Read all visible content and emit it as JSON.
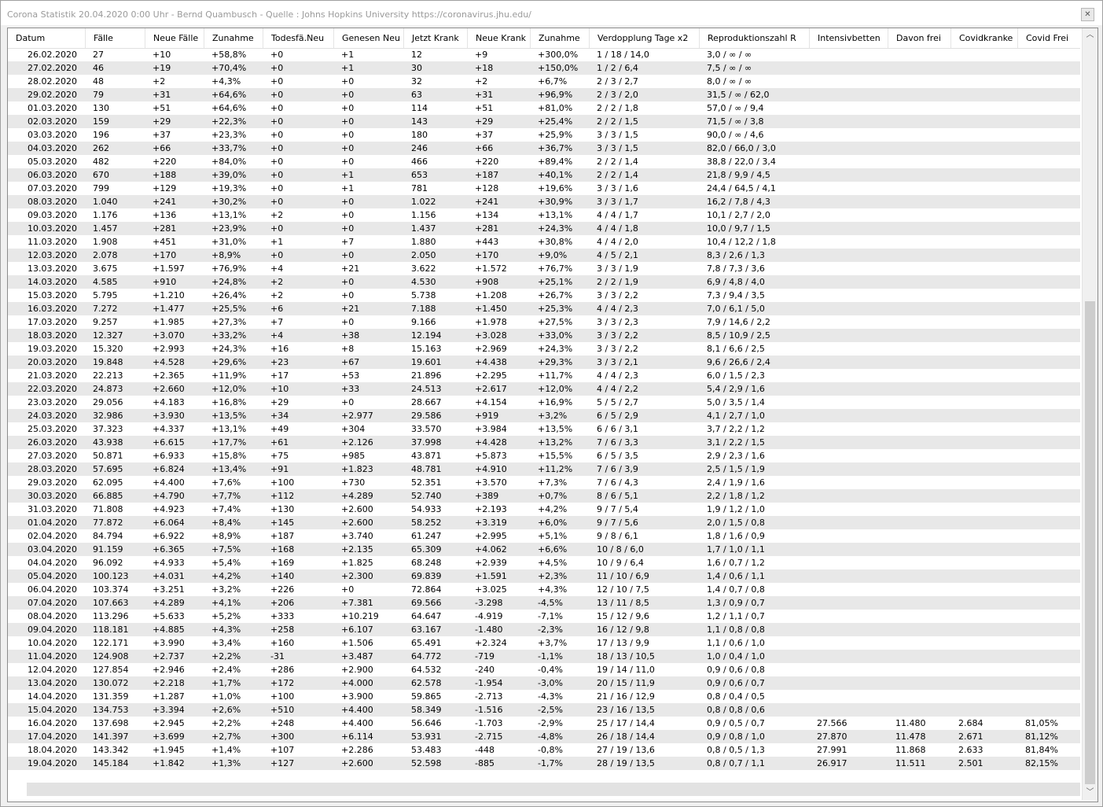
{
  "window": {
    "title": "Corona Statistik 20.04.2020 0:00 Uhr - Bernd Quambusch - Quelle : Johns Hopkins University https://coronavirus.jhu.edu/",
    "close_glyph": "✕"
  },
  "table": {
    "columns": [
      "Datum",
      "Fälle",
      "Neue Fälle",
      "Zunahme",
      "Todesfä.Neu",
      "Genesen Neu",
      "Jetzt Krank",
      "Neue Krank",
      "Zunahme",
      "Verdopplung Tage x2",
      "Reproduktionszahl R",
      "Intensivbetten",
      "Davon frei",
      "Covidkranke",
      "Covid Frei"
    ],
    "rows": [
      [
        "26.02.2020",
        "27",
        "+10",
        "+58,8%",
        "+0",
        "+1",
        "12",
        "+9",
        "+300,0%",
        "1  /  18  /  14,0",
        "3,0  /  ∞  /  ∞",
        "",
        "",
        "",
        ""
      ],
      [
        "27.02.2020",
        "46",
        "+19",
        "+70,4%",
        "+0",
        "+1",
        "30",
        "+18",
        "+150,0%",
        "1  /  2  /  6,4",
        "7,5  /  ∞  /  ∞",
        "",
        "",
        "",
        ""
      ],
      [
        "28.02.2020",
        "48",
        "+2",
        "+4,3%",
        "+0",
        "+0",
        "32",
        "+2",
        "+6,7%",
        "2  /  3  /  2,7",
        "8,0  /  ∞  /  ∞",
        "",
        "",
        "",
        ""
      ],
      [
        "29.02.2020",
        "79",
        "+31",
        "+64,6%",
        "+0",
        "+0",
        "63",
        "+31",
        "+96,9%",
        "2  /  3  /  2,0",
        "31,5  /  ∞  /  62,0",
        "",
        "",
        "",
        ""
      ],
      [
        "01.03.2020",
        "130",
        "+51",
        "+64,6%",
        "+0",
        "+0",
        "114",
        "+51",
        "+81,0%",
        "2  /  2  /  1,8",
        "57,0  /  ∞  /  9,4",
        "",
        "",
        "",
        ""
      ],
      [
        "02.03.2020",
        "159",
        "+29",
        "+22,3%",
        "+0",
        "+0",
        "143",
        "+29",
        "+25,4%",
        "2  /  2  /  1,5",
        "71,5  /  ∞  /  3,8",
        "",
        "",
        "",
        ""
      ],
      [
        "03.03.2020",
        "196",
        "+37",
        "+23,3%",
        "+0",
        "+0",
        "180",
        "+37",
        "+25,9%",
        "3  /  3  /  1,5",
        "90,0  /  ∞  /  4,6",
        "",
        "",
        "",
        ""
      ],
      [
        "04.03.2020",
        "262",
        "+66",
        "+33,7%",
        "+0",
        "+0",
        "246",
        "+66",
        "+36,7%",
        "3  /  3  /  1,5",
        "82,0  /  66,0  /  3,0",
        "",
        "",
        "",
        ""
      ],
      [
        "05.03.2020",
        "482",
        "+220",
        "+84,0%",
        "+0",
        "+0",
        "466",
        "+220",
        "+89,4%",
        "2  /  2  /  1,4",
        "38,8  /  22,0  /  3,4",
        "",
        "",
        "",
        ""
      ],
      [
        "06.03.2020",
        "670",
        "+188",
        "+39,0%",
        "+0",
        "+1",
        "653",
        "+187",
        "+40,1%",
        "2  /  2  /  1,4",
        "21,8  /  9,9  /  4,5",
        "",
        "",
        "",
        ""
      ],
      [
        "07.03.2020",
        "799",
        "+129",
        "+19,3%",
        "+0",
        "+1",
        "781",
        "+128",
        "+19,6%",
        "3  /  3  /  1,6",
        "24,4  /  64,5  /  4,1",
        "",
        "",
        "",
        ""
      ],
      [
        "08.03.2020",
        "1.040",
        "+241",
        "+30,2%",
        "+0",
        "+0",
        "1.022",
        "+241",
        "+30,9%",
        "3  /  3  /  1,7",
        "16,2  /  7,8  /  4,3",
        "",
        "",
        "",
        ""
      ],
      [
        "09.03.2020",
        "1.176",
        "+136",
        "+13,1%",
        "+2",
        "+0",
        "1.156",
        "+134",
        "+13,1%",
        "4  /  4  /  1,7",
        "10,1  /  2,7  /  2,0",
        "",
        "",
        "",
        ""
      ],
      [
        "10.03.2020",
        "1.457",
        "+281",
        "+23,9%",
        "+0",
        "+0",
        "1.437",
        "+281",
        "+24,3%",
        "4  /  4  /  1,8",
        "10,0  /  9,7  /  1,5",
        "",
        "",
        "",
        ""
      ],
      [
        "11.03.2020",
        "1.908",
        "+451",
        "+31,0%",
        "+1",
        "+7",
        "1.880",
        "+443",
        "+30,8%",
        "4  /  4  /  2,0",
        "10,4  /  12,2  /  1,8",
        "",
        "",
        "",
        ""
      ],
      [
        "12.03.2020",
        "2.078",
        "+170",
        "+8,9%",
        "+0",
        "+0",
        "2.050",
        "+170",
        "+9,0%",
        "4  /  5  /  2,1",
        "8,3  /  2,6  /  1,3",
        "",
        "",
        "",
        ""
      ],
      [
        "13.03.2020",
        "3.675",
        "+1.597",
        "+76,9%",
        "+4",
        "+21",
        "3.622",
        "+1.572",
        "+76,7%",
        "3  /  3  /  1,9",
        "7,8  /  7,3  /  3,6",
        "",
        "",
        "",
        ""
      ],
      [
        "14.03.2020",
        "4.585",
        "+910",
        "+24,8%",
        "+2",
        "+0",
        "4.530",
        "+908",
        "+25,1%",
        "2  /  2  /  1,9",
        "6,9  /  4,8  /  4,0",
        "",
        "",
        "",
        ""
      ],
      [
        "15.03.2020",
        "5.795",
        "+1.210",
        "+26,4%",
        "+2",
        "+0",
        "5.738",
        "+1.208",
        "+26,7%",
        "3  /  3  /  2,2",
        "7,3  /  9,4  /  3,5",
        "",
        "",
        "",
        ""
      ],
      [
        "16.03.2020",
        "7.272",
        "+1.477",
        "+25,5%",
        "+6",
        "+21",
        "7.188",
        "+1.450",
        "+25,3%",
        "4  /  4  /  2,3",
        "7,0  /  6,1  /  5,0",
        "",
        "",
        "",
        ""
      ],
      [
        "17.03.2020",
        "9.257",
        "+1.985",
        "+27,3%",
        "+7",
        "+0",
        "9.166",
        "+1.978",
        "+27,5%",
        "3  /  3  /  2,3",
        "7,9  /  14,6  /  2,2",
        "",
        "",
        "",
        ""
      ],
      [
        "18.03.2020",
        "12.327",
        "+3.070",
        "+33,2%",
        "+4",
        "+38",
        "12.194",
        "+3.028",
        "+33,0%",
        "3  /  3  /  2,2",
        "8,5  /  10,9  /  2,5",
        "",
        "",
        "",
        ""
      ],
      [
        "19.03.2020",
        "15.320",
        "+2.993",
        "+24,3%",
        "+16",
        "+8",
        "15.163",
        "+2.969",
        "+24,3%",
        "3  /  3  /  2,2",
        "8,1  /  6,6  /  2,5",
        "",
        "",
        "",
        ""
      ],
      [
        "20.03.2020",
        "19.848",
        "+4.528",
        "+29,6%",
        "+23",
        "+67",
        "19.601",
        "+4.438",
        "+29,3%",
        "3  /  3  /  2,1",
        "9,6  /  26,6  /  2,4",
        "",
        "",
        "",
        ""
      ],
      [
        "21.03.2020",
        "22.213",
        "+2.365",
        "+11,9%",
        "+17",
        "+53",
        "21.896",
        "+2.295",
        "+11,7%",
        "4  /  4  /  2,3",
        "6,0  /  1,5  /  2,3",
        "",
        "",
        "",
        ""
      ],
      [
        "22.03.2020",
        "24.873",
        "+2.660",
        "+12,0%",
        "+10",
        "+33",
        "24.513",
        "+2.617",
        "+12,0%",
        "4  /  4  /  2,2",
        "5,4  /  2,9  /  1,6",
        "",
        "",
        "",
        ""
      ],
      [
        "23.03.2020",
        "29.056",
        "+4.183",
        "+16,8%",
        "+29",
        "+0",
        "28.667",
        "+4.154",
        "+16,9%",
        "5  /  5  /  2,7",
        "5,0  /  3,5  /  1,4",
        "",
        "",
        "",
        ""
      ],
      [
        "24.03.2020",
        "32.986",
        "+3.930",
        "+13,5%",
        "+34",
        "+2.977",
        "29.586",
        "+919",
        "+3,2%",
        "6  /  5  /  2,9",
        "4,1  /  2,7  /  1,0",
        "",
        "",
        "",
        ""
      ],
      [
        "25.03.2020",
        "37.323",
        "+4.337",
        "+13,1%",
        "+49",
        "+304",
        "33.570",
        "+3.984",
        "+13,5%",
        "6  /  6  /  3,1",
        "3,7  /  2,2  /  1,2",
        "",
        "",
        "",
        ""
      ],
      [
        "26.03.2020",
        "43.938",
        "+6.615",
        "+17,7%",
        "+61",
        "+2.126",
        "37.998",
        "+4.428",
        "+13,2%",
        "7  /  6  /  3,3",
        "3,1  /  2,2  /  1,5",
        "",
        "",
        "",
        ""
      ],
      [
        "27.03.2020",
        "50.871",
        "+6.933",
        "+15,8%",
        "+75",
        "+985",
        "43.871",
        "+5.873",
        "+15,5%",
        "6  /  5  /  3,5",
        "2,9  /  2,3  /  1,6",
        "",
        "",
        "",
        ""
      ],
      [
        "28.03.2020",
        "57.695",
        "+6.824",
        "+13,4%",
        "+91",
        "+1.823",
        "48.781",
        "+4.910",
        "+11,2%",
        "7  /  6  /  3,9",
        "2,5  /  1,5  /  1,9",
        "",
        "",
        "",
        ""
      ],
      [
        "29.03.2020",
        "62.095",
        "+4.400",
        "+7,6%",
        "+100",
        "+730",
        "52.351",
        "+3.570",
        "+7,3%",
        "7  /  6  /  4,3",
        "2,4  /  1,9  /  1,6",
        "",
        "",
        "",
        ""
      ],
      [
        "30.03.2020",
        "66.885",
        "+4.790",
        "+7,7%",
        "+112",
        "+4.289",
        "52.740",
        "+389",
        "+0,7%",
        "8  /  6  /  5,1",
        "2,2  /  1,8  /  1,2",
        "",
        "",
        "",
        ""
      ],
      [
        "31.03.2020",
        "71.808",
        "+4.923",
        "+7,4%",
        "+130",
        "+2.600",
        "54.933",
        "+2.193",
        "+4,2%",
        "9  /  7  /  5,4",
        "1,9  /  1,2  /  1,0",
        "",
        "",
        "",
        ""
      ],
      [
        "01.04.2020",
        "77.872",
        "+6.064",
        "+8,4%",
        "+145",
        "+2.600",
        "58.252",
        "+3.319",
        "+6,0%",
        "9  /  7  /  5,6",
        "2,0  /  1,5  /  0,8",
        "",
        "",
        "",
        ""
      ],
      [
        "02.04.2020",
        "84.794",
        "+6.922",
        "+8,9%",
        "+187",
        "+3.740",
        "61.247",
        "+2.995",
        "+5,1%",
        "9  /  8  /  6,1",
        "1,8  /  1,6  /  0,9",
        "",
        "",
        "",
        ""
      ],
      [
        "03.04.2020",
        "91.159",
        "+6.365",
        "+7,5%",
        "+168",
        "+2.135",
        "65.309",
        "+4.062",
        "+6,6%",
        "10  /  8  /  6,0",
        "1,7  /  1,0  /  1,1",
        "",
        "",
        "",
        ""
      ],
      [
        "04.04.2020",
        "96.092",
        "+4.933",
        "+5,4%",
        "+169",
        "+1.825",
        "68.248",
        "+2.939",
        "+4,5%",
        "10  /  9  /  6,4",
        "1,6  /  0,7  /  1,2",
        "",
        "",
        "",
        ""
      ],
      [
        "05.04.2020",
        "100.123",
        "+4.031",
        "+4,2%",
        "+140",
        "+2.300",
        "69.839",
        "+1.591",
        "+2,3%",
        "11  /  10  /  6,9",
        "1,4  /  0,6  /  1,1",
        "",
        "",
        "",
        ""
      ],
      [
        "06.04.2020",
        "103.374",
        "+3.251",
        "+3,2%",
        "+226",
        "+0",
        "72.864",
        "+3.025",
        "+4,3%",
        "12  /  10  /  7,5",
        "1,4  /  0,7  /  0,8",
        "",
        "",
        "",
        ""
      ],
      [
        "07.04.2020",
        "107.663",
        "+4.289",
        "+4,1%",
        "+206",
        "+7.381",
        "69.566",
        "-3.298",
        "-4,5%",
        "13  /  11  /  8,5",
        "1,3  /  0,9  /  0,7",
        "",
        "",
        "",
        ""
      ],
      [
        "08.04.2020",
        "113.296",
        "+5.633",
        "+5,2%",
        "+333",
        "+10.219",
        "64.647",
        "-4.919",
        "-7,1%",
        "15  /  12  /  9,6",
        "1,2  /  1,1  /  0,7",
        "",
        "",
        "",
        ""
      ],
      [
        "09.04.2020",
        "118.181",
        "+4.885",
        "+4,3%",
        "+258",
        "+6.107",
        "63.167",
        "-1.480",
        "-2,3%",
        "16  /  12  /  9,8",
        "1,1  /  0,8  /  0,8",
        "",
        "",
        "",
        ""
      ],
      [
        "10.04.2020",
        "122.171",
        "+3.990",
        "+3,4%",
        "+160",
        "+1.506",
        "65.491",
        "+2.324",
        "+3,7%",
        "17  /  13  /  9,9",
        "1,1  /  0,6  /  1,0",
        "",
        "",
        "",
        ""
      ],
      [
        "11.04.2020",
        "124.908",
        "+2.737",
        "+2,2%",
        "-31",
        "+3.487",
        "64.772",
        "-719",
        "-1,1%",
        "18  /  13  /  10,5",
        "1,0  /  0,4  /  1,0",
        "",
        "",
        "",
        ""
      ],
      [
        "12.04.2020",
        "127.854",
        "+2.946",
        "+2,4%",
        "+286",
        "+2.900",
        "64.532",
        "-240",
        "-0,4%",
        "19  /  14  /  11,0",
        "0,9  /  0,6  /  0,8",
        "",
        "",
        "",
        ""
      ],
      [
        "13.04.2020",
        "130.072",
        "+2.218",
        "+1,7%",
        "+172",
        "+4.000",
        "62.578",
        "-1.954",
        "-3,0%",
        "20  /  15  /  11,9",
        "0,9  /  0,6  /  0,7",
        "",
        "",
        "",
        ""
      ],
      [
        "14.04.2020",
        "131.359",
        "+1.287",
        "+1,0%",
        "+100",
        "+3.900",
        "59.865",
        "-2.713",
        "-4,3%",
        "21  /  16  /  12,9",
        "0,8  /  0,4  /  0,5",
        "",
        "",
        "",
        ""
      ],
      [
        "15.04.2020",
        "134.753",
        "+3.394",
        "+2,6%",
        "+510",
        "+4.400",
        "58.349",
        "-1.516",
        "-2,5%",
        "23  /  16  /  13,5",
        "0,8  /  0,8  /  0,6",
        "",
        "",
        "",
        ""
      ],
      [
        "16.04.2020",
        "137.698",
        "+2.945",
        "+2,2%",
        "+248",
        "+4.400",
        "56.646",
        "-1.703",
        "-2,9%",
        "25  /  17  /  14,4",
        "0,9  /  0,5  /  0,7",
        "27.566",
        "11.480",
        "2.684",
        "81,05%"
      ],
      [
        "17.04.2020",
        "141.397",
        "+3.699",
        "+2,7%",
        "+300",
        "+6.114",
        "53.931",
        "-2.715",
        "-4,8%",
        "26  /  18  /  14,4",
        "0,9  /  0,8  /  1,0",
        "27.870",
        "11.478",
        "2.671",
        "81,12%"
      ],
      [
        "18.04.2020",
        "143.342",
        "+1.945",
        "+1,4%",
        "+107",
        "+2.286",
        "53.483",
        "-448",
        "-0,8%",
        "27  /  19  /  13,6",
        "0,8  /  0,5  /  1,3",
        "27.991",
        "11.868",
        "2.633",
        "81,84%"
      ],
      [
        "19.04.2020",
        "145.184",
        "+1.842",
        "+1,3%",
        "+127",
        "+2.600",
        "52.598",
        "-885",
        "-1,7%",
        "28  /  19  /  13,5",
        "0,8  /  0,7  /  1,1",
        "26.917",
        "11.511",
        "2.501",
        "82,15%"
      ]
    ]
  },
  "scrollbar": {
    "up_glyph": "︿",
    "down_glyph": "﹀"
  }
}
